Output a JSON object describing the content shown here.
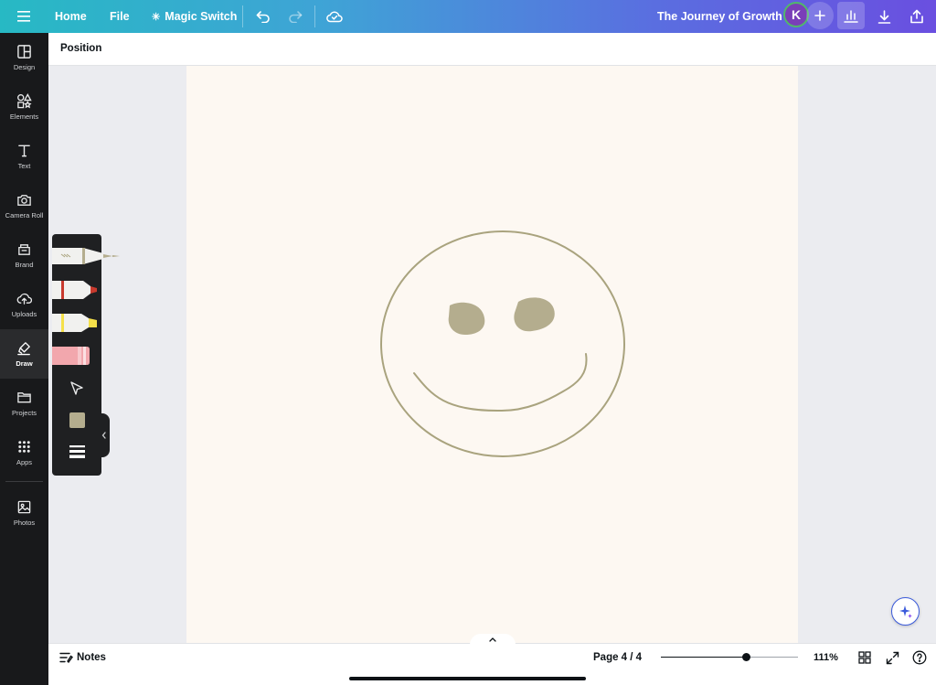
{
  "topbar": {
    "home": "Home",
    "file": "File",
    "magic_switch": "Magic Switch",
    "title": "The Journey of Growth",
    "avatar_initial": "K"
  },
  "sidebar": {
    "items": [
      {
        "label": "Design",
        "icon": "layout-icon"
      },
      {
        "label": "Elements",
        "icon": "shapes-icon"
      },
      {
        "label": "Text",
        "icon": "text-icon"
      },
      {
        "label": "Camera Roll",
        "icon": "camera-icon"
      },
      {
        "label": "Brand",
        "icon": "brand-icon"
      },
      {
        "label": "Uploads",
        "icon": "cloud-upload-icon"
      },
      {
        "label": "Draw",
        "icon": "draw-icon"
      },
      {
        "label": "Projects",
        "icon": "folder-icon"
      },
      {
        "label": "Apps",
        "icon": "apps-grid-icon"
      },
      {
        "label": "Photos",
        "icon": "image-icon"
      }
    ],
    "active": "Draw"
  },
  "position_bar": {
    "label": "Position"
  },
  "canvas": {
    "stroke_color": "#a9a37e",
    "fill_color": "#b4ad8e",
    "page_color": "#fdf8f2"
  },
  "draw_tools": {
    "selected_color": "#b4ad8e",
    "tools": [
      "pen",
      "marker",
      "highlighter",
      "eraser",
      "select"
    ]
  },
  "bottombar": {
    "notes": "Notes",
    "page": "Page 4 / 4",
    "zoom": "111%",
    "zoom_fraction": 0.62
  },
  "colors": {
    "accent": "#3b5bdb",
    "sidebar_bg": "#18191b"
  }
}
